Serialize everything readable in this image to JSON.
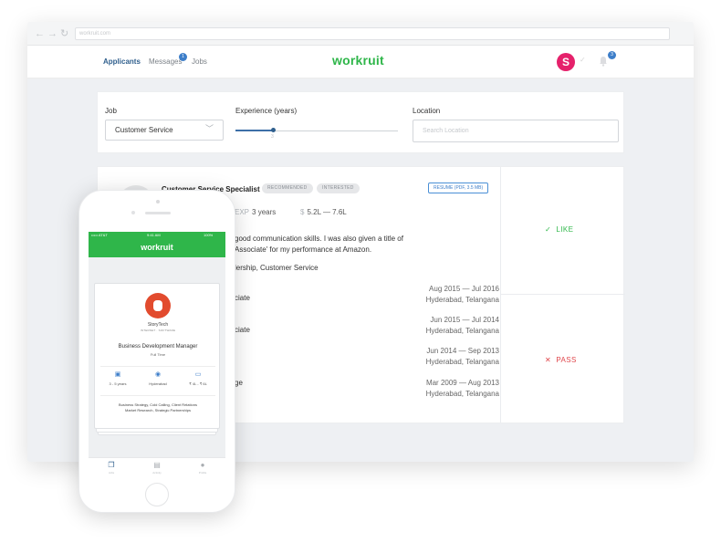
{
  "browser": {
    "url": "workruit.com",
    "nav_icons": [
      "back-arrow-icon",
      "forward-arrow-icon",
      "reload-icon"
    ]
  },
  "nav": {
    "links": [
      "Applicants",
      "Messages",
      "Jobs"
    ],
    "messages_badge": "1",
    "logo": "workruit",
    "avatar_initial": "S",
    "notifications_badge": "3"
  },
  "filters": {
    "job_label": "Job",
    "job_value": "Customer Service",
    "experience_label": "Experience (years)",
    "experience_value": 3,
    "experience_value_text": "3",
    "location_label": "Location",
    "location_placeholder": "Search Location"
  },
  "applicant": {
    "title": "Customer Service Specialist",
    "tags": [
      "RECOMMENDED",
      "INTERESTED"
    ],
    "resume": "RESUME (PDF, 3.5 MB)",
    "exp_key": "EXP",
    "exp_value": "3 years",
    "salary_key": "$",
    "salary_value": "5.2L — 7.6L",
    "summary_line1": "good communication skills. I was also given a title of",
    "summary_line2": "Associate' for my performance at Amazon.",
    "skills": "lership, Customer Service",
    "experience": [
      {
        "role": "ciate",
        "dates": "Aug 2015 — Jul 2016",
        "place": "Hyderabad, Telangana"
      },
      {
        "role": "ciate",
        "dates": "Jun 2015 — Jul 2014",
        "place": "Hyderabad, Telangana"
      },
      {
        "role": "",
        "dates": "Jun 2014 — Sep 2013",
        "place": "Hyderabad, Telangana"
      },
      {
        "role": "ge",
        "dates": "Mar 2009 — Aug 2013",
        "place": "Hyderabad, Telangana"
      }
    ],
    "like_label": "LIKE",
    "pass_label": "PASS"
  },
  "phone": {
    "carrier": "••••• AT&T",
    "time": "9:41 AM",
    "battery": "100%",
    "logo": "workruit",
    "company": "StoryTech",
    "industry": "INTERNET · SOFTWARE",
    "position": "Business Development Manager",
    "employment": "Full Time",
    "stats": [
      "3 - 5 years",
      "Hyderabad",
      "₹ 4L - ₹ 6L"
    ],
    "skills_line1": "Business Strategy, Cold Calling, Client Relations",
    "skills_line2": "Market Research, Strategic Partnerships",
    "tabs": [
      "Jobs",
      "Activity",
      "Profile"
    ]
  },
  "colors": {
    "brand_green": "#2fb64a",
    "accent_blue": "#2f5f8d",
    "like_green": "#30b84b",
    "pass_red": "#e0474c",
    "avatar_pink": "#e5216b"
  }
}
